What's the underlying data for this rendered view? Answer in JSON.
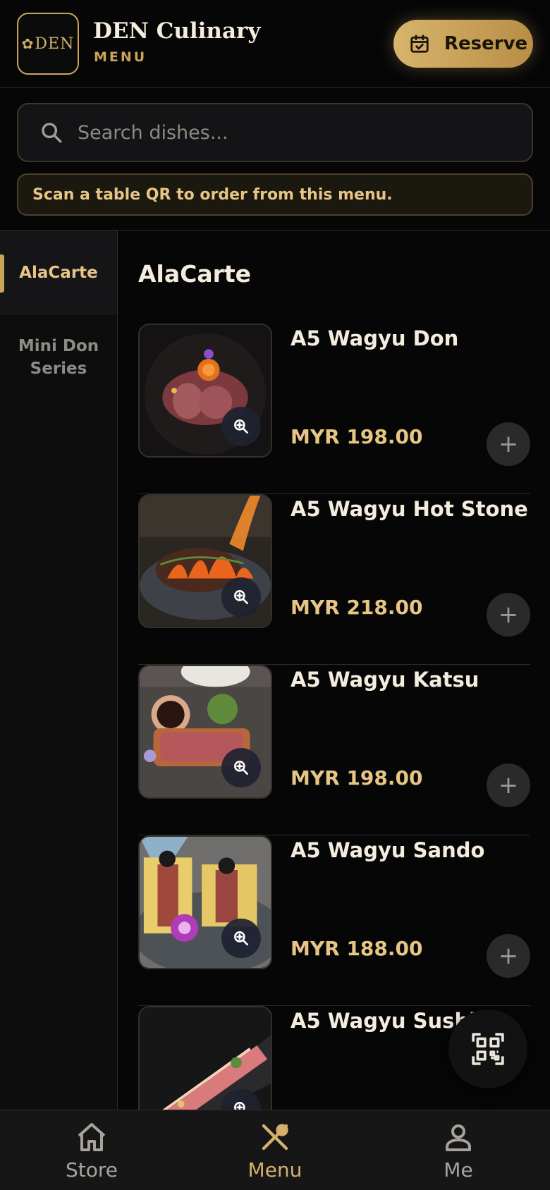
{
  "header": {
    "logo_text": "DEN",
    "title": "DEN Culinary",
    "subtitle": "MENU",
    "reserve_label": "Reserve"
  },
  "search": {
    "placeholder": "Search dishes...",
    "value": ""
  },
  "notice": "Scan a table QR to order from this menu.",
  "sidebar": {
    "categories": [
      {
        "label": "AlaCarte",
        "active": true
      },
      {
        "label": "Mini Don Series",
        "active": false
      }
    ]
  },
  "main": {
    "section_title": "AlaCarte",
    "items": [
      {
        "name": "A5 Wagyu Don",
        "price": "MYR 198.00"
      },
      {
        "name": "A5 Wagyu Hot Stone",
        "price": "MYR 218.00"
      },
      {
        "name": "A5 Wagyu Katsu",
        "price": "MYR 198.00"
      },
      {
        "name": "A5 Wagyu Sando",
        "price": "MYR 188.00"
      },
      {
        "name": "A5 Wagyu Sushi",
        "price": ""
      }
    ]
  },
  "bottom_nav": {
    "store": "Store",
    "menu": "Menu",
    "me": "Me",
    "active": "Menu"
  },
  "colors": {
    "accent": "#c9a45a",
    "price": "#e7c585",
    "background": "#060607"
  }
}
